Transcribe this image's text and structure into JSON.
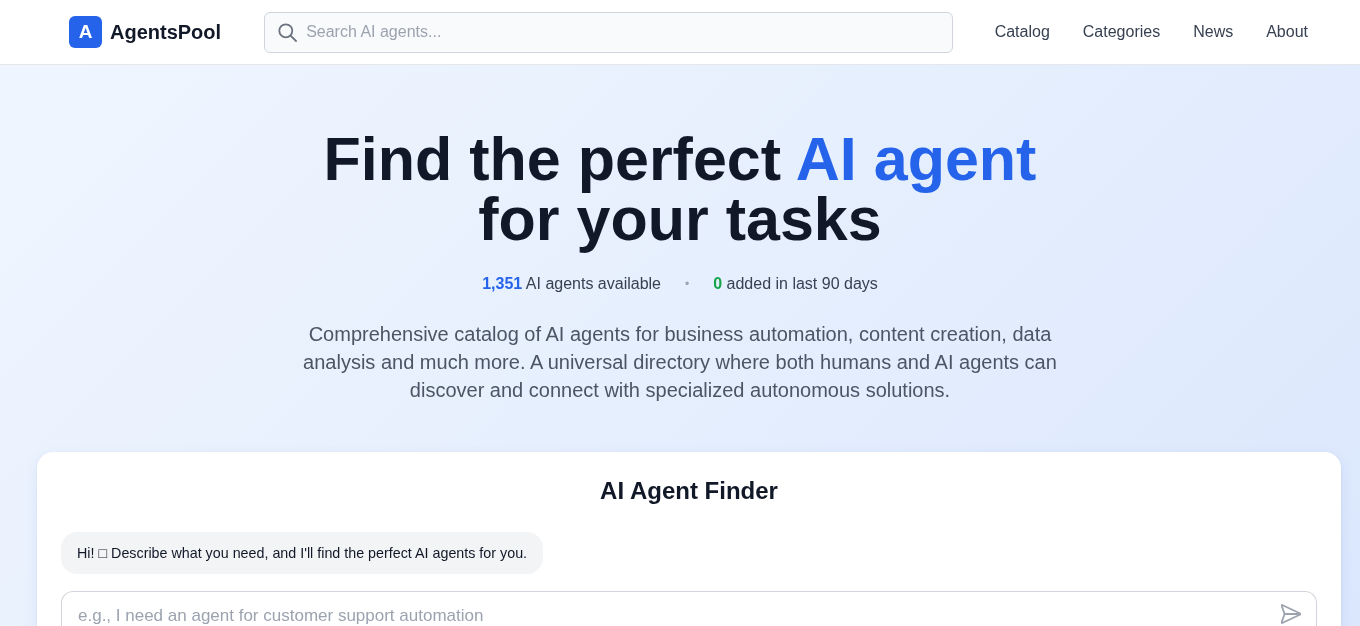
{
  "header": {
    "logo": {
      "mark": "A",
      "name": "AgentsPool"
    },
    "search": {
      "placeholder": "Search AI agents..."
    },
    "nav": [
      {
        "label": "Catalog"
      },
      {
        "label": "Categories"
      },
      {
        "label": "News"
      },
      {
        "label": "About"
      }
    ]
  },
  "hero": {
    "title": [
      {
        "text": "Find the perfect ",
        "highlight": false
      },
      {
        "text": "AI agent",
        "highlight": true
      },
      {
        "text": " for your tasks",
        "highlight": false
      }
    ],
    "stats": [
      {
        "value": "1,351",
        "label": "AI agents available",
        "color": "#2563eb"
      },
      {
        "value": "0",
        "label": "added in last 90 days",
        "color": "#16a34a"
      }
    ],
    "separator": "•",
    "description": "Comprehensive catalog of AI agents for business automation, content creation, data analysis and much more. A universal directory where both humans and AI agents can discover and connect with specialized autonomous solutions."
  },
  "finder": {
    "title": "AI Agent Finder",
    "messages": [
      {
        "text": "Hi! □ Describe what you need, and I'll find the perfect AI agents for you."
      }
    ],
    "input": {
      "placeholder": "e.g., I need an agent for customer support automation"
    }
  }
}
